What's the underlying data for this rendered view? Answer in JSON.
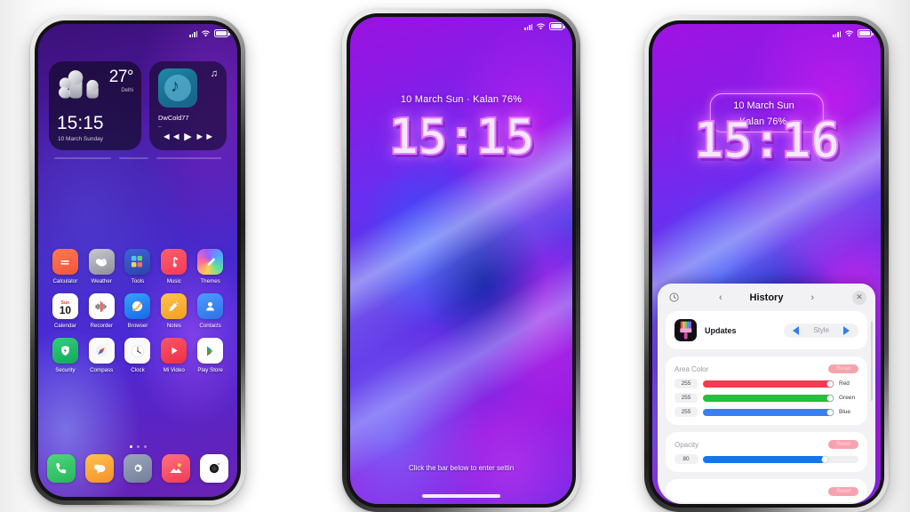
{
  "scene": {
    "background_color": "#ffffff",
    "device_count": 3
  },
  "status_bar": {
    "signal_icon": "signal-bars-icon",
    "wifi_icon": "wifi-icon",
    "battery_icon": "battery-icon"
  },
  "phone1": {
    "label": "home-screen",
    "weather_widget": {
      "temperature": "27°",
      "city": "Delhi",
      "time": "15:15",
      "date": "10 March Sunday",
      "condition_icon": "cloudy-icon"
    },
    "music_widget": {
      "track_title": "DwCold77",
      "artist": "–",
      "note_icon": "music-note-icon",
      "prev_label": "◄◄",
      "play_label": "▶",
      "next_label": "►►"
    },
    "apps_row1": [
      {
        "label": "Calculator",
        "icon": "calculator-icon"
      },
      {
        "label": "Weather",
        "icon": "weather-icon"
      },
      {
        "label": "Tools",
        "icon": "tools-folder-icon"
      },
      {
        "label": "Music",
        "icon": "music-icon"
      },
      {
        "label": "Themes",
        "icon": "themes-icon"
      }
    ],
    "apps_row2": [
      {
        "label": "Calendar",
        "icon": "calendar-icon",
        "day_name": "Sun",
        "day_number": "10"
      },
      {
        "label": "Recorder",
        "icon": "recorder-icon"
      },
      {
        "label": "Browser",
        "icon": "browser-icon"
      },
      {
        "label": "Notes",
        "icon": "notes-icon"
      },
      {
        "label": "Contacts",
        "icon": "contacts-icon"
      }
    ],
    "apps_row3": [
      {
        "label": "Security",
        "icon": "security-shield-icon"
      },
      {
        "label": "Compass",
        "icon": "compass-icon"
      },
      {
        "label": "Clock",
        "icon": "clock-icon"
      },
      {
        "label": "Mi Video",
        "icon": "mi-video-icon"
      },
      {
        "label": "Play Store",
        "icon": "play-store-icon"
      }
    ],
    "page_dots": {
      "count": 3,
      "active_index": 0
    },
    "dock": [
      {
        "icon": "phone-icon"
      },
      {
        "icon": "messages-icon"
      },
      {
        "icon": "settings-gear-icon"
      },
      {
        "icon": "gallery-icon"
      },
      {
        "icon": "camera-icon"
      }
    ]
  },
  "phone2": {
    "label": "lock-screen",
    "date_text": "10 March Sun · Kalan 76%",
    "time_text": "15:15",
    "hint_text": "Click the bar below to enter settin",
    "home_indicator": "home-bar"
  },
  "phone3": {
    "label": "lock-screen-with-editor",
    "date_text": "10 March Sun · Kalan 76%",
    "time_text": "15:16",
    "panel": {
      "title": "History",
      "prev_icon": "chevron-left-icon",
      "next_icon": "chevron-right-icon",
      "history_icon": "history-clock-icon",
      "close_icon": "close-icon",
      "updates_row": {
        "name": "Updates",
        "icon": "paintbrush-icon",
        "style_label": "Style",
        "prev_icon": "triangle-left-icon",
        "next_icon": "triangle-right-icon"
      },
      "area_color": {
        "title": "Area Color",
        "reset_label": "Reset",
        "sliders": [
          {
            "name": "Red",
            "value": "255",
            "percent": 100,
            "color": "#f53b52"
          },
          {
            "name": "Green",
            "value": "255",
            "percent": 100,
            "color": "#1fc23c"
          },
          {
            "name": "Blue",
            "value": "255",
            "percent": 100,
            "color": "#3a7ef0"
          }
        ]
      },
      "opacity": {
        "title": "Opacity",
        "reset_label": "Reset",
        "slider": {
          "name": "",
          "value": "80",
          "percent": 78,
          "color": "#1277ef"
        }
      }
    }
  }
}
